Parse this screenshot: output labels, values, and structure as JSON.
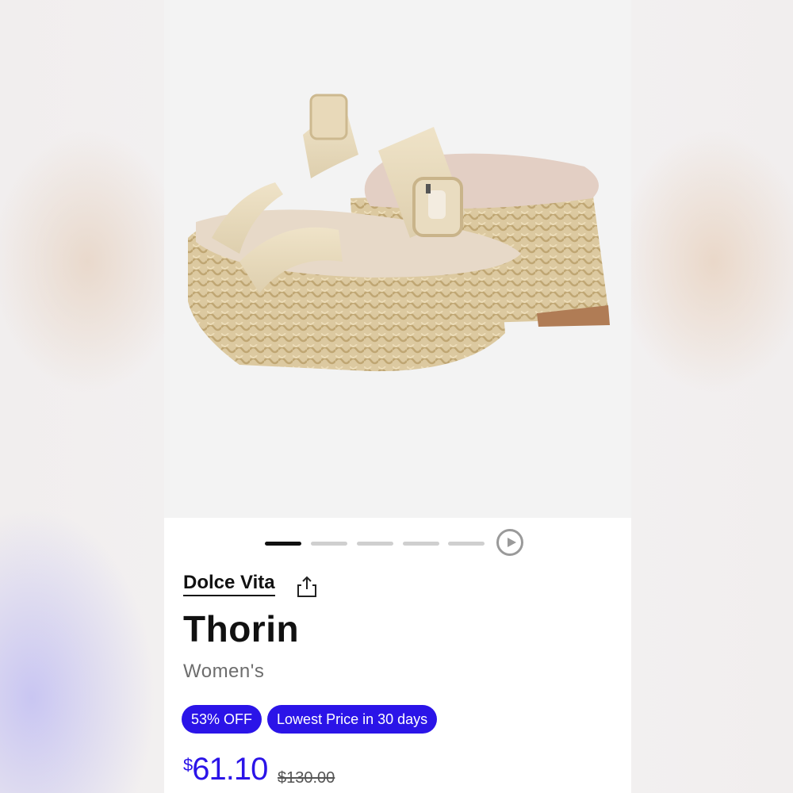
{
  "product": {
    "brand": "Dolce Vita",
    "name": "Thorin",
    "gender": "Women's",
    "badges": [
      "53% OFF",
      "Lowest Price in 30 days"
    ],
    "price_currency": "$",
    "price_value": "61.10",
    "original_price": "$130.00"
  },
  "gallery": {
    "image_count": 5,
    "active_index": 0,
    "image_subject": "woven platform slide sandal"
  },
  "icons": {
    "share": "share-icon",
    "play": "play-icon"
  },
  "colors": {
    "accent": "#2b14e8",
    "text": "#111111",
    "muted": "#6d6d6d",
    "pager_inactive": "#cfcfcf",
    "hero_bg": "#f3f3f3"
  }
}
